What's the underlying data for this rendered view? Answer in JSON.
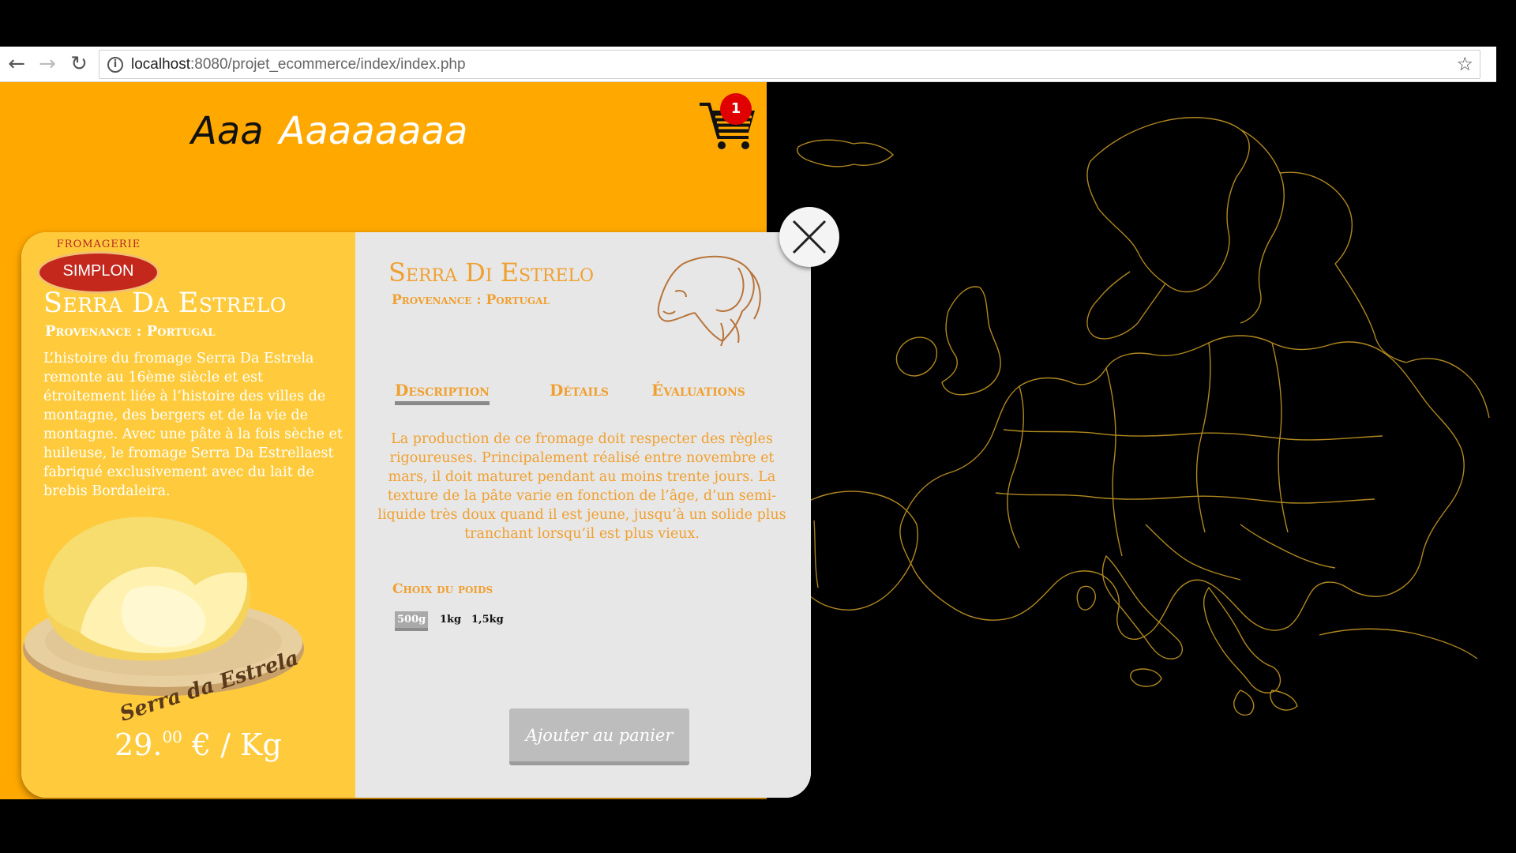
{
  "browser": {
    "back_icon": "arrow-left-icon",
    "forward_icon": "arrow-right-icon",
    "reload_icon": "reload-icon",
    "url_host": "localhost",
    "url_path": ":8080/projet_ecommerce/index/index.php",
    "bookmark_icon": "star-icon"
  },
  "header": {
    "brand_part1": "Aaa",
    "brand_part2": "Aaaaaaaa",
    "cart_icon": "shopping-cart-icon",
    "cart_count": "1",
    "brand_color": "#ffa800",
    "badge_color": "#e00000"
  },
  "product_card": {
    "logo_top": "FROMAGERIE",
    "logo_name": "SIMPLON",
    "title": "Serra Da Estrelo",
    "provenance": "Provenance : Portugal",
    "history": "L’histoire du fromage Serra Da Estrela remonte au 16ème siècle et est étroitement liée à l’histoire des villes de montagne, des bergers et de la vie de montagne. Avec une pâte à la fois  sèche et huileuse, le fromage Serra Da Estrellaest fabriqué exclusivement avec du lait de brebis Bordaleira.",
    "board_label": "Serra da Estrela",
    "price_int": "29.",
    "price_dec": "00",
    "price_unit": "€ / Kg"
  },
  "details": {
    "title": "Serra Di Estrelo",
    "provenance": "Provenance : Portugal",
    "ram_icon": "ram-head-icon",
    "tabs": [
      {
        "label": "Description",
        "active": true
      },
      {
        "label": "Détails",
        "active": false
      },
      {
        "label": "Évaluations",
        "active": false
      }
    ],
    "description": "La production de ce fromage doit respecter des règles rigoureuses. Principalement  réalisé entre novembre et mars, il doit maturet pendant au moins trente jours. La texture de la pâte varie en fonction de l’âge, d’un semi-liquide très doux quand il est jeune, jusqu’à un solide plus tranchant lorsqu’il est plus vieux.",
    "weight_label": "Choix du poids",
    "weights": [
      "500g",
      "1kg",
      "1,5kg"
    ],
    "selected_weight": "500g",
    "add_to_cart": "Ajouter au panier",
    "accent_color": "#f0a030"
  },
  "close_icon": "close-x-icon"
}
